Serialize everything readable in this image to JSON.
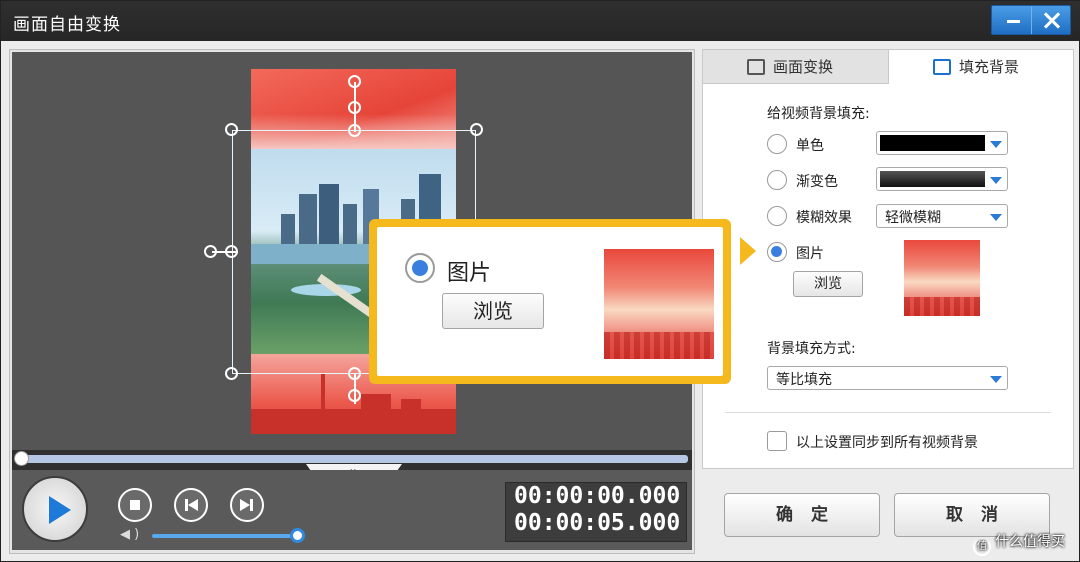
{
  "window": {
    "title": "画面自由变换",
    "minimize_icon": "minimize-icon",
    "close_icon": "close-icon",
    "accent": "#2f7fd6"
  },
  "tabs": [
    {
      "label": "画面变换",
      "icon": "transform-icon",
      "active": false
    },
    {
      "label": "填充背景",
      "icon": "fill-background-icon",
      "active": true
    }
  ],
  "fill_panel": {
    "section_label": "给视频背景填充:",
    "options": [
      {
        "label": "单色",
        "selected": false,
        "control": "color-dropdown",
        "swatch": "#000000"
      },
      {
        "label": "渐变色",
        "selected": false,
        "control": "gradient-dropdown",
        "swatch": "#333333"
      },
      {
        "label": "模糊效果",
        "selected": false,
        "control": "blur-dropdown",
        "value": "轻微模糊"
      },
      {
        "label": "图片",
        "selected": true,
        "control": "browse-button",
        "button_label": "浏览"
      }
    ],
    "fill_mode_label": "背景填充方式:",
    "fill_mode_value": "等比填充",
    "sync_label": "以上设置同步到所有视频背景",
    "sync_checked": false
  },
  "actions": {
    "ok_label": "确定",
    "cancel_label": "取消"
  },
  "player": {
    "current_time": "00:00:00.000",
    "total_time": "00:00:05.000",
    "progress": 0,
    "volume": 1.0
  },
  "callout": {
    "radio_label": "图片",
    "button_label": "浏览",
    "border_color": "#f5b81d"
  },
  "watermark": {
    "text": "什么值得买"
  }
}
